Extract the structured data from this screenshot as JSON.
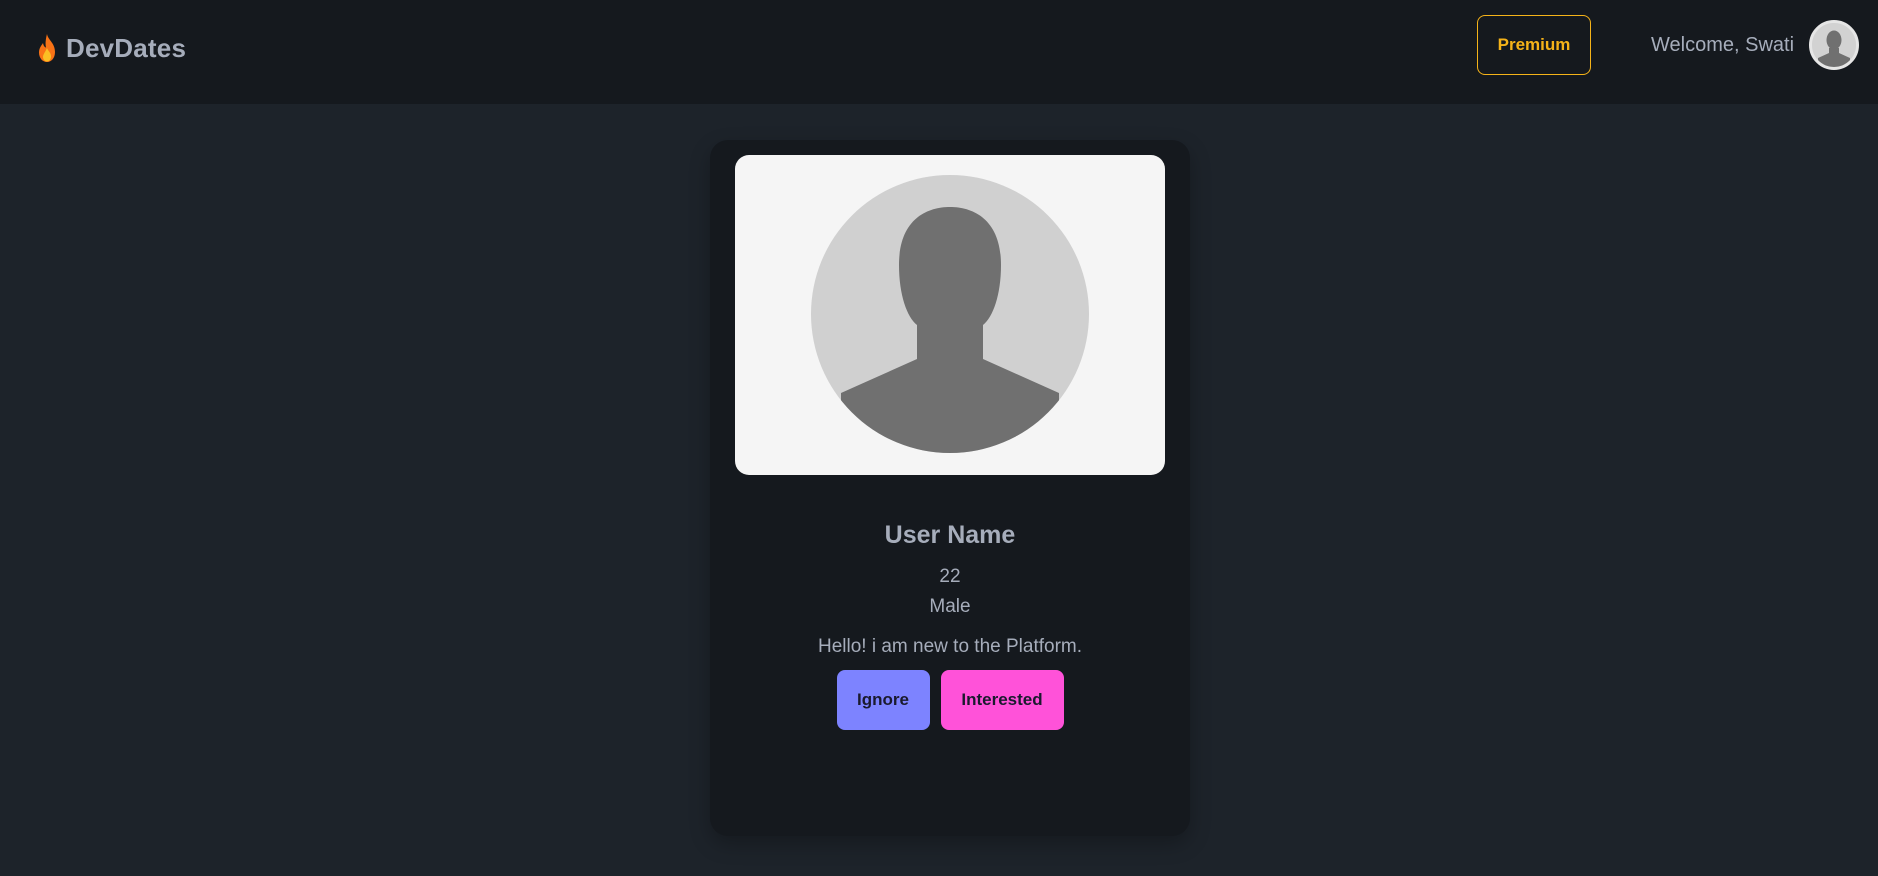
{
  "navbar": {
    "brand": "DevDates",
    "premium_label": "Premium",
    "welcome_text": "Welcome, Swati"
  },
  "profile_card": {
    "name": "User Name",
    "age": "22",
    "gender": "Male",
    "about": "Hello! i am new to the Platform.",
    "ignore_label": "Ignore",
    "interested_label": "Interested"
  },
  "colors": {
    "page_bg": "#1d232a",
    "navbar_bg": "#15191e",
    "card_bg": "#15191e",
    "premium": "#f5b319",
    "ignore": "#7d83ff",
    "interested": "#ff52d9",
    "flame": "#f97316"
  },
  "icons": {
    "brand": "flame-icon",
    "avatar": "user-silhouette-icon",
    "profile_photo": "user-silhouette-icon"
  }
}
